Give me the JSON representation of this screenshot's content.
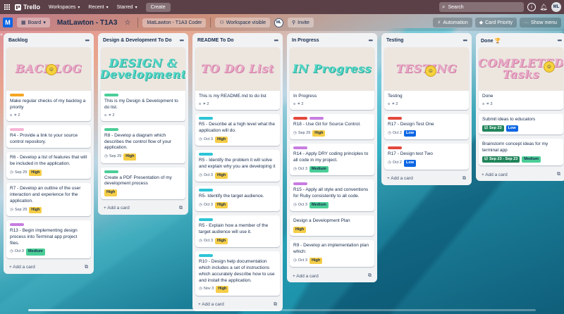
{
  "app": {
    "name": "Trello"
  },
  "topbar": {
    "workspaces": "Workspaces",
    "recent": "Recent",
    "starred": "Starred",
    "create": "Create",
    "search_placeholder": "Search",
    "avatar": "ML"
  },
  "board": {
    "view": "Board",
    "title": "MatLawton - T1A3",
    "member_chip": "MatLawton - T1A3 Coder",
    "visibility": "Workspace visible",
    "member_avatar": "ML",
    "invite": "Invite",
    "automation": "Automation",
    "card_priority": "Card Priority",
    "show_menu": "Show menu"
  },
  "add_card_label": "Add a card",
  "lists": [
    {
      "title": "Backlog",
      "cover_text": "BACKLOG",
      "cover_body": "Make regular checks of my backlog a priority",
      "cover_label": "#f5a623",
      "cover_checklist": "2",
      "cards": [
        {
          "text": "R4 - Provide a link to your source control repository.",
          "label": "#f6b5d6",
          "date": "",
          "priority": "",
          "ptype": ""
        },
        {
          "text": "R6 - Develop a list of features that will be included in the application.",
          "label": "",
          "date": "Sep 29",
          "priority": "High",
          "ptype": "high"
        },
        {
          "text": "R7 - Develop an outline of the user interaction and experience for the application.",
          "label": "",
          "date": "Sep 29",
          "priority": "High",
          "ptype": "high"
        },
        {
          "text": "R13 - Begin implementing design process into Terminal app project files.",
          "label": "#c77de0",
          "date": "Oct 3",
          "priority": "Medium",
          "ptype": "medium"
        }
      ]
    },
    {
      "title": "Design & Development To Do",
      "cover_text": "DESIGN & Development",
      "cover_body": "This is my Design & Development to do list.",
      "cover_label": "#4bce97",
      "cover_checklist": "2",
      "cards": [
        {
          "text": "R8 - Develop a diagram which describes the control flow of your application.",
          "label": "#4bce97",
          "date": "Sep 29",
          "priority": "High",
          "ptype": "high"
        },
        {
          "text": "Create a PDF Presentation of my development process",
          "label": "#4bce97",
          "date": "",
          "priority": "High",
          "ptype": "high"
        }
      ]
    },
    {
      "title": "README To Do",
      "cover_text": "TO DO List",
      "cover_body": "This is my README.md to do list",
      "cover_label": "",
      "cover_checklist": "2",
      "cards": [
        {
          "text": "R5 - Describe at a high level what the application will do.",
          "label": "#2ec4d6",
          "date": "Oct 3",
          "priority": "High",
          "ptype": "high"
        },
        {
          "text": "R5 - Identify the problem it will solve and explain why you are developing it",
          "label": "#2ec4d6",
          "date": "Oct 3",
          "priority": "High",
          "ptype": "high"
        },
        {
          "text": "R5- Identify the target audience.",
          "label": "#2ec4d6",
          "date": "Oct 3",
          "priority": "High",
          "ptype": "high"
        },
        {
          "text": "R5 - Explain how a member of the target audience will use it.",
          "label": "#2ec4d6",
          "date": "Oct 3",
          "priority": "High",
          "ptype": "high"
        },
        {
          "text": "R10 - Design help documentation which includes a set of instructions which accurately describe how to use and install the application.",
          "label": "#2ec4d6",
          "date": "Nov 3",
          "priority": "High",
          "ptype": "high"
        }
      ]
    },
    {
      "title": "In Progress",
      "cover_text": "IN Progress",
      "cover_body": "In Progress",
      "cover_label": "",
      "cover_checklist": "2",
      "cards": [
        {
          "text": "R18 - Use Git for Source Control.",
          "label": "#e2483d",
          "label2": "#c77de0",
          "date": "Sep 29",
          "priority": "High",
          "ptype": "high"
        },
        {
          "text": "R14 - Apply DRY coding principles to all code in my project.",
          "label": "#c77de0",
          "date": "Oct 3",
          "priority": "Medium",
          "ptype": "medium"
        },
        {
          "text": "R15 - Apply all style and conventions for Ruby consistently to all code.",
          "label": "#c77de0",
          "date": "Oct 3",
          "priority": "Medium",
          "ptype": "medium"
        },
        {
          "text": "Design a Development Plan",
          "label": "",
          "date": "",
          "priority": "High",
          "ptype": "high"
        },
        {
          "text": "R9 - Develop an implementation plan which:",
          "label": "",
          "date": "Oct 3",
          "priority": "High",
          "ptype": "high"
        }
      ]
    },
    {
      "title": "Testing",
      "cover_text": "TESTING",
      "cover_body": "Testing",
      "cover_label": "",
      "cover_checklist": "2",
      "cards": [
        {
          "text": "R17 - Design Test One",
          "label": "#e2483d",
          "date": "Oct 2",
          "priority": "Low",
          "ptype": "low"
        },
        {
          "text": "R17 - Design test Two",
          "label": "#e2483d",
          "date": "Oct 2",
          "priority": "Low",
          "ptype": "low"
        }
      ]
    },
    {
      "title": "Done 🏆",
      "cover_text": "COMPLETED Tasks",
      "cover_body": "Done",
      "cover_label": "",
      "cover_checklist": "3",
      "cards": [
        {
          "text": "Submit ideas to educators",
          "label": "",
          "date": "Sep 23",
          "done": true,
          "priority": "Low",
          "ptype": "low"
        },
        {
          "text": "Brainstorm concept ideas for my terminal app",
          "label": "",
          "date": "Sep 23 - Sep 23",
          "done": true,
          "priority": "Medium",
          "ptype": "medium"
        }
      ]
    }
  ]
}
